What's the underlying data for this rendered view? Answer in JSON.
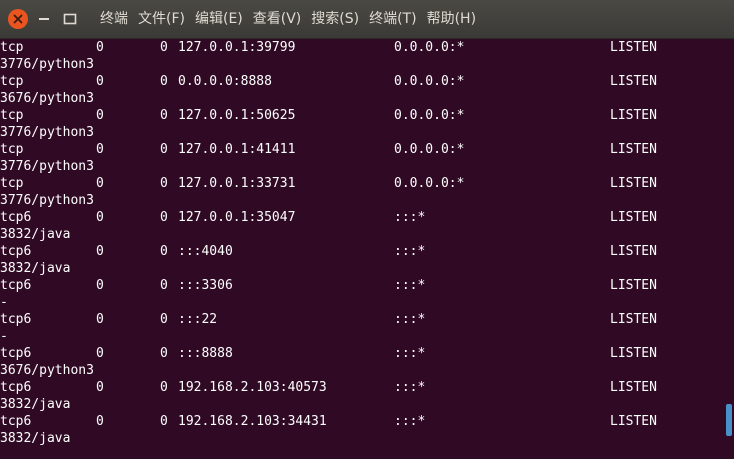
{
  "menubar": {
    "items": [
      "终端",
      "文件(F)",
      "编辑(E)",
      "查看(V)",
      "搜索(S)",
      "终端(T)",
      "帮助(H)"
    ]
  },
  "colors": {
    "terminal_bg": "#300a24",
    "titlebar_bg": "#3b3a36",
    "close_button": "#e9541f",
    "text": "#ffffff"
  },
  "terminal": {
    "rows": [
      {
        "proto": "tcp",
        "recv_q": "0",
        "send_q": "0",
        "local": "127.0.0.1:39799",
        "foreign": "0.0.0.0:*",
        "state": "LISTEN",
        "program": "3776/python3"
      },
      {
        "proto": "tcp",
        "recv_q": "0",
        "send_q": "0",
        "local": "0.0.0.0:8888",
        "foreign": "0.0.0.0:*",
        "state": "LISTEN",
        "program": "3676/python3"
      },
      {
        "proto": "tcp",
        "recv_q": "0",
        "send_q": "0",
        "local": "127.0.0.1:50625",
        "foreign": "0.0.0.0:*",
        "state": "LISTEN",
        "program": "3776/python3"
      },
      {
        "proto": "tcp",
        "recv_q": "0",
        "send_q": "0",
        "local": "127.0.0.1:41411",
        "foreign": "0.0.0.0:*",
        "state": "LISTEN",
        "program": "3776/python3"
      },
      {
        "proto": "tcp",
        "recv_q": "0",
        "send_q": "0",
        "local": "127.0.0.1:33731",
        "foreign": "0.0.0.0:*",
        "state": "LISTEN",
        "program": "3776/python3"
      },
      {
        "proto": "tcp6",
        "recv_q": "0",
        "send_q": "0",
        "local": "127.0.0.1:35047",
        "foreign": ":::*",
        "state": "LISTEN",
        "program": "3832/java"
      },
      {
        "proto": "tcp6",
        "recv_q": "0",
        "send_q": "0",
        "local": ":::4040",
        "foreign": ":::*",
        "state": "LISTEN",
        "program": "3832/java"
      },
      {
        "proto": "tcp6",
        "recv_q": "0",
        "send_q": "0",
        "local": ":::3306",
        "foreign": ":::*",
        "state": "LISTEN",
        "program": "-"
      },
      {
        "proto": "tcp6",
        "recv_q": "0",
        "send_q": "0",
        "local": ":::22",
        "foreign": ":::*",
        "state": "LISTEN",
        "program": "-"
      },
      {
        "proto": "tcp6",
        "recv_q": "0",
        "send_q": "0",
        "local": ":::8888",
        "foreign": ":::*",
        "state": "LISTEN",
        "program": "3676/python3"
      },
      {
        "proto": "tcp6",
        "recv_q": "0",
        "send_q": "0",
        "local": "192.168.2.103:40573",
        "foreign": ":::*",
        "state": "LISTEN",
        "program": "3832/java"
      },
      {
        "proto": "tcp6",
        "recv_q": "0",
        "send_q": "0",
        "local": "192.168.2.103:34431",
        "foreign": ":::*",
        "state": "LISTEN",
        "program": "3832/java"
      }
    ]
  }
}
